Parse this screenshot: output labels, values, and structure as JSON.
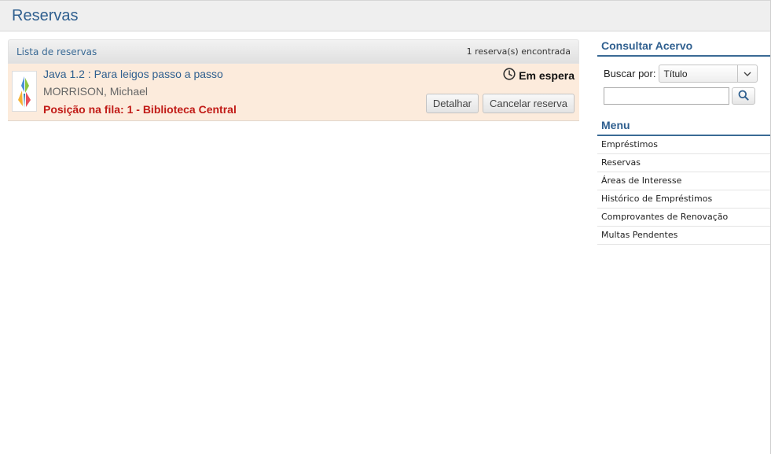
{
  "header": {
    "title": "Reservas"
  },
  "list": {
    "title": "Lista de reservas",
    "count": "1 reserva(s) encontrada",
    "items": [
      {
        "book_title": "Java 1.2 : Para leigos passo a passo",
        "author": "MORRISON, Michael",
        "queue_position": "Posição na fila: 1 - Biblioteca Central",
        "status": "Em espera",
        "detail_button": "Detalhar",
        "cancel_button": "Cancelar reserva"
      }
    ]
  },
  "sidebar": {
    "search_title": "Consultar Acervo",
    "search_by_label": "Buscar por:",
    "search_by_value": "Título",
    "search_input_value": "",
    "menu_title": "Menu",
    "menu_items": [
      "Empréstimos",
      "Reservas",
      "Áreas de Interesse",
      "Histórico de Empréstimos",
      "Comprovantes de Renovação",
      "Multas Pendentes"
    ]
  },
  "colors": {
    "accent": "#2f5f8f",
    "alert": "#c11b17",
    "item_bg": "#fcebdc"
  },
  "icons": {
    "status": "clock-icon",
    "search": "magnifier-icon",
    "select": "chevron-down-icon"
  }
}
